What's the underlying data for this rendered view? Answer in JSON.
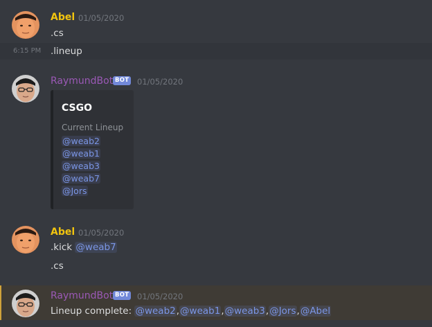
{
  "messages": [
    {
      "author": "Abel",
      "timestamp": "01/05/2020",
      "lines": [
        ".cs"
      ],
      "followup": {
        "time": "6:15 PM",
        "text": ".lineup"
      }
    },
    {
      "author": "RaymundBot",
      "bot_tag": "BOT",
      "timestamp": "01/05/2020",
      "embed": {
        "title": "CSGO",
        "field_name": "Current Lineup",
        "mentions": [
          "@weab2",
          "@weab1",
          "@weab3",
          "@weab7",
          "@Jors"
        ]
      }
    },
    {
      "author": "Abel",
      "timestamp": "01/05/2020",
      "lines": [
        ".kick",
        ".cs"
      ],
      "mention": "@weab7"
    },
    {
      "author": "RaymundBot",
      "bot_tag": "BOT",
      "timestamp": "01/05/2020",
      "text_prefix": "Lineup complete: ",
      "mentions": [
        "@weab2",
        "@weab1",
        "@weab3",
        "@Jors",
        "@Abel"
      ],
      "separator": ","
    }
  ],
  "colors": {
    "background": "#36393f",
    "abel_name": "#f1c40f",
    "bot_name": "#9b59b6",
    "bot_tag": "#7289da",
    "mention_text": "#7b96e6",
    "highlight_bar": "#d1a33b"
  }
}
